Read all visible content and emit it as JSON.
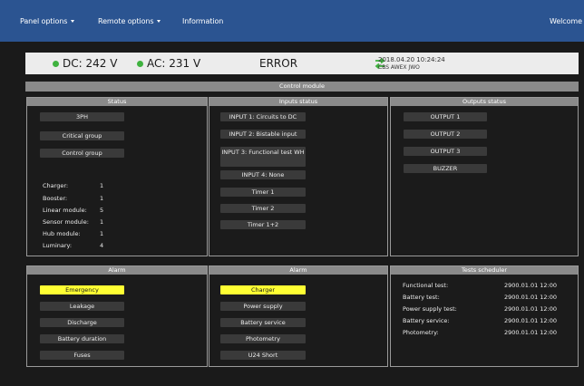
{
  "nav": {
    "panel_options": "Panel options",
    "remote_options": "Remote options",
    "information": "Information",
    "welcome": "Welcome"
  },
  "statusbar": {
    "dc": "DC: 242 V",
    "ac": "AC: 231 V",
    "state": "ERROR",
    "datetime": "2018.04.20 10:24:24",
    "device": "CBS AWEX JWO",
    "indicator_color": "#3fb23f"
  },
  "control_module": "Control module",
  "status_panel": {
    "title": "Status",
    "buttons": [
      "3PH",
      "Critical group",
      "Control group"
    ],
    "rows": [
      {
        "label": "Charger:",
        "value": "1"
      },
      {
        "label": "Booster:",
        "value": "1"
      },
      {
        "label": "Linear module:",
        "value": "5"
      },
      {
        "label": "Sensor module:",
        "value": "1"
      },
      {
        "label": "Hub module:",
        "value": "1"
      },
      {
        "label": "Luminary:",
        "value": "4"
      }
    ]
  },
  "inputs_panel": {
    "title": "Inputs status",
    "buttons": [
      "INPUT 1: Circuits to DC",
      "INPUT 2: Bistable input",
      "INPUT 3: Functional test WH",
      "INPUT 4: None",
      "Timer 1",
      "Timer 2",
      "Timer 1+2"
    ]
  },
  "outputs_panel": {
    "title": "Outputs status",
    "buttons": [
      "OUTPUT 1",
      "OUTPUT 2",
      "OUTPUT 3",
      "BUZZER"
    ]
  },
  "alarm_left": {
    "title": "Alarm",
    "buttons": [
      "Emergency",
      "Leakage",
      "Discharge",
      "Battery duration",
      "Fuses"
    ],
    "active_color": "#ffff33"
  },
  "alarm_mid": {
    "title": "Alarm",
    "buttons": [
      "Charger",
      "Power supply",
      "Battery service",
      "Photometry",
      "U24 Short"
    ]
  },
  "scheduler": {
    "title": "Tests scheduler",
    "rows": [
      {
        "label": "Functional test:",
        "value": "2900.01.01 12:00"
      },
      {
        "label": "Battery test:",
        "value": "2900.01.01 12:00"
      },
      {
        "label": "Power supply test:",
        "value": "2900.01.01 12:00"
      },
      {
        "label": "Battery service:",
        "value": "2900.01.01 12:00"
      },
      {
        "label": "Photometry:",
        "value": "2900.01.01 12:00"
      }
    ]
  }
}
